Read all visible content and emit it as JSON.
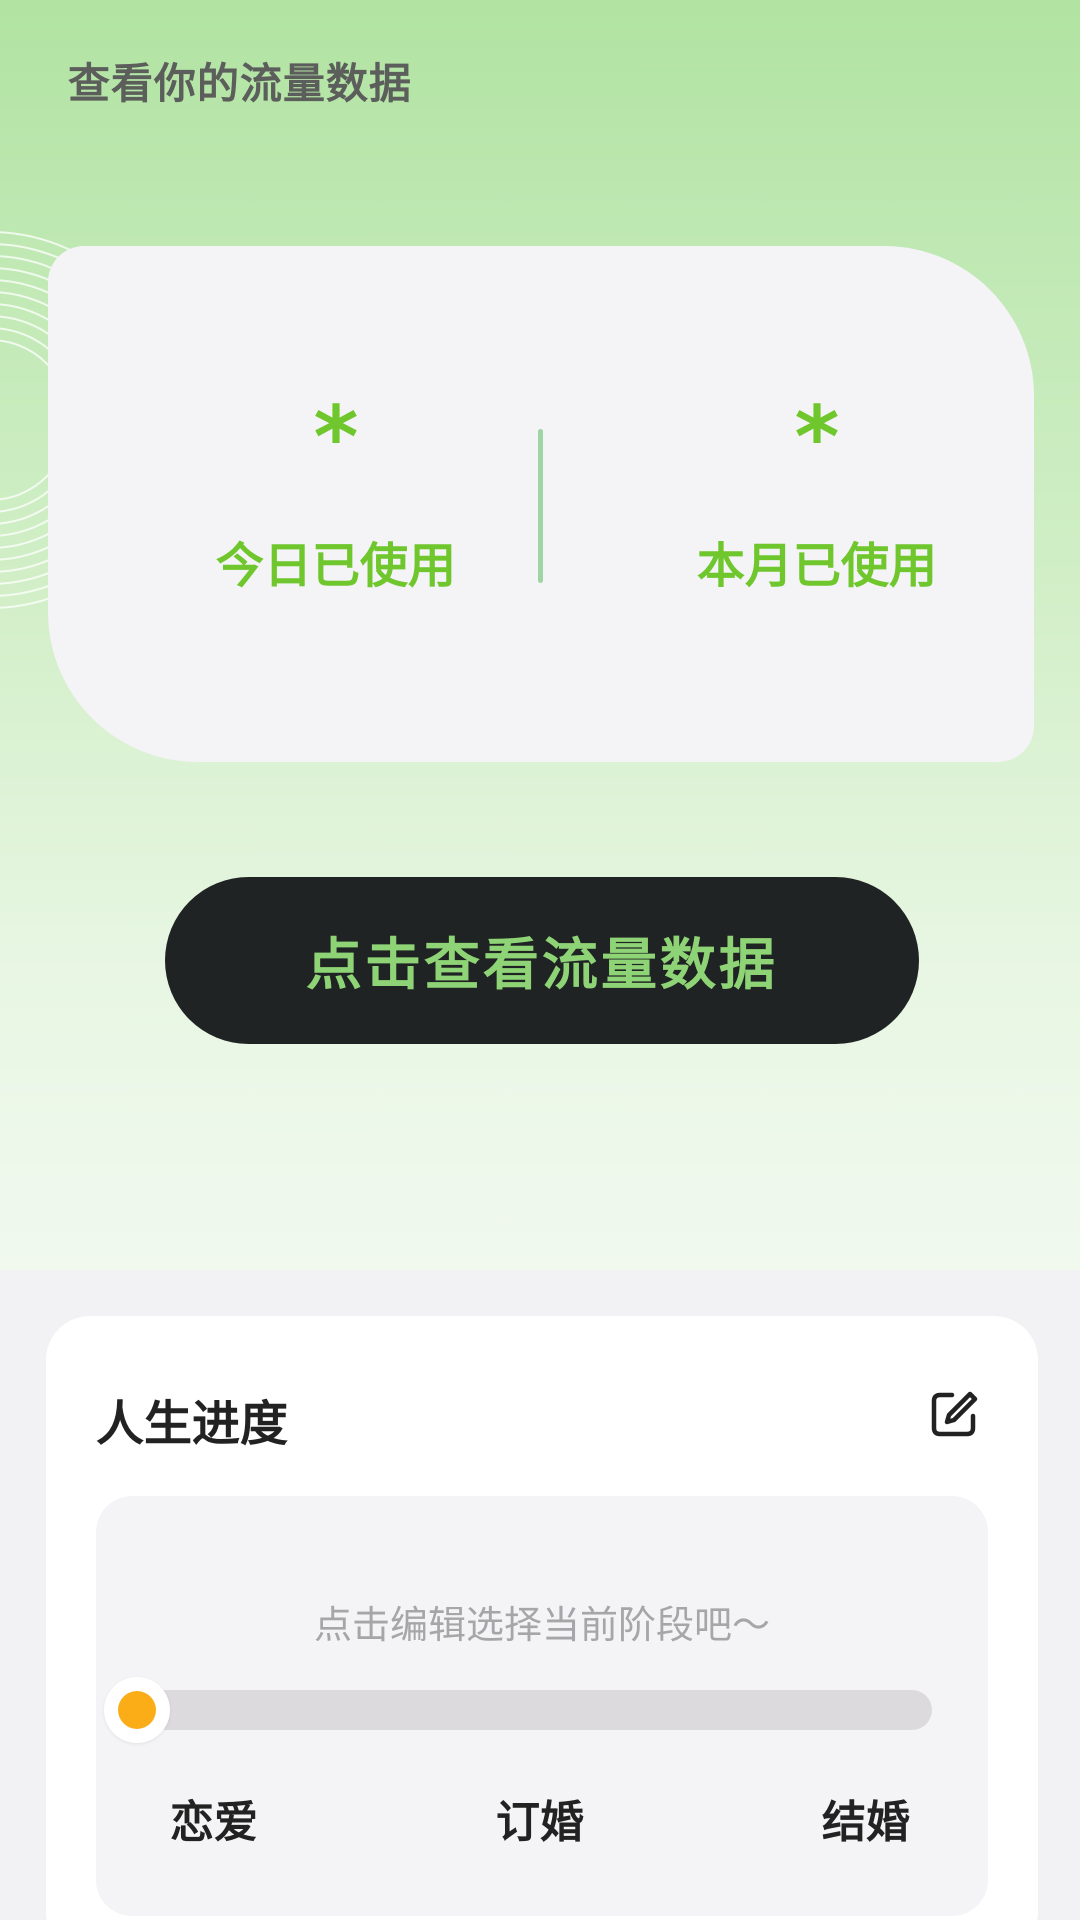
{
  "header": {
    "title": "查看你的流量数据"
  },
  "usage": {
    "today": {
      "value": "*",
      "label": "今日已使用"
    },
    "month": {
      "value": "*",
      "label": "本月已使用"
    }
  },
  "actions": {
    "view_button_label": "点击查看流量数据"
  },
  "progress": {
    "title": "人生进度",
    "hint": "点击编辑选择当前阶段吧～",
    "current_progress": 0,
    "stages": [
      "恋爱",
      "订婚",
      "结婚"
    ]
  },
  "colors": {
    "accent_green": "#6fc72d",
    "button_dark": "#202323",
    "button_text": "#8ed476",
    "knob": "#fbad18",
    "track": "#dcdadd"
  },
  "icons": {
    "edit": "edit-icon"
  }
}
